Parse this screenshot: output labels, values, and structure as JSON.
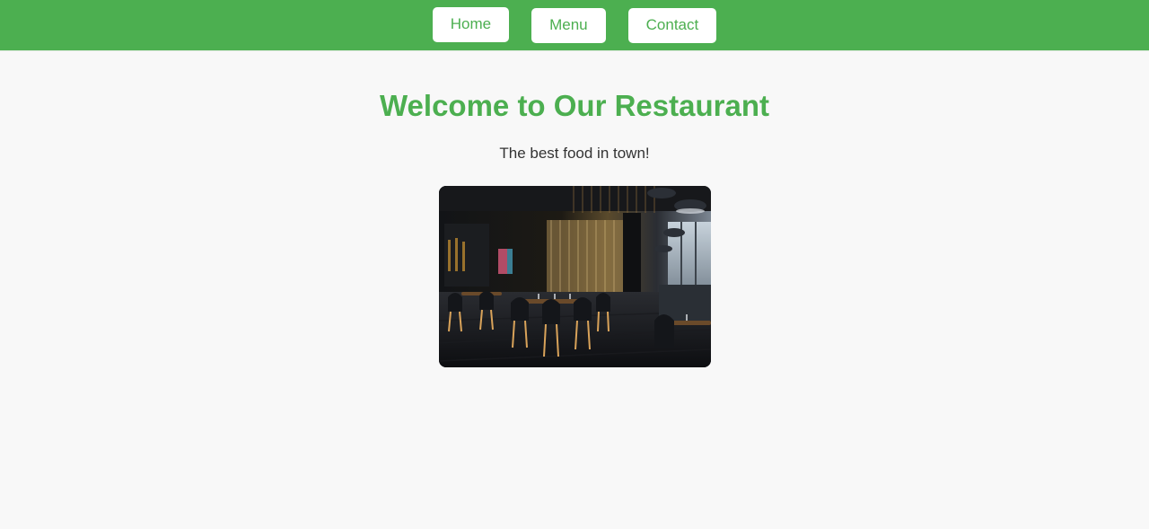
{
  "nav": {
    "items": [
      {
        "label": "Home"
      },
      {
        "label": "Menu"
      },
      {
        "label": "Contact"
      }
    ]
  },
  "main": {
    "title": "Welcome to Our Restaurant",
    "tagline": "The best food in town!"
  },
  "colors": {
    "accent": "#4caf50",
    "background": "#f8f8f8",
    "text": "#333333"
  },
  "icons": {
    "hero_image": "restaurant-interior-photo"
  }
}
